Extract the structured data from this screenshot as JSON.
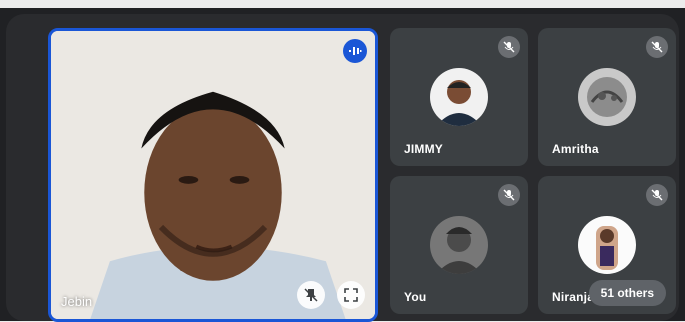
{
  "meeting": {
    "main_participant": {
      "name": "Jebin",
      "speaking_icon": "audio-wave-icon",
      "pin_icon": "pin-off-icon",
      "fullscreen_icon": "fullscreen-icon"
    },
    "participants": [
      {
        "name": "JIMMY",
        "muted": true,
        "mute_icon": "mic-off-icon"
      },
      {
        "name": "Amritha",
        "muted": true,
        "mute_icon": "mic-off-icon"
      },
      {
        "name": "You",
        "muted": true,
        "mute_icon": "mic-off-icon"
      },
      {
        "name": "Niranjan",
        "muted": true,
        "mute_icon": "mic-off-icon"
      }
    ],
    "others_label": "51 others"
  },
  "colors": {
    "accent": "#1a56d6",
    "tile_bg": "#3c4043",
    "stage_bg": "#202124"
  }
}
